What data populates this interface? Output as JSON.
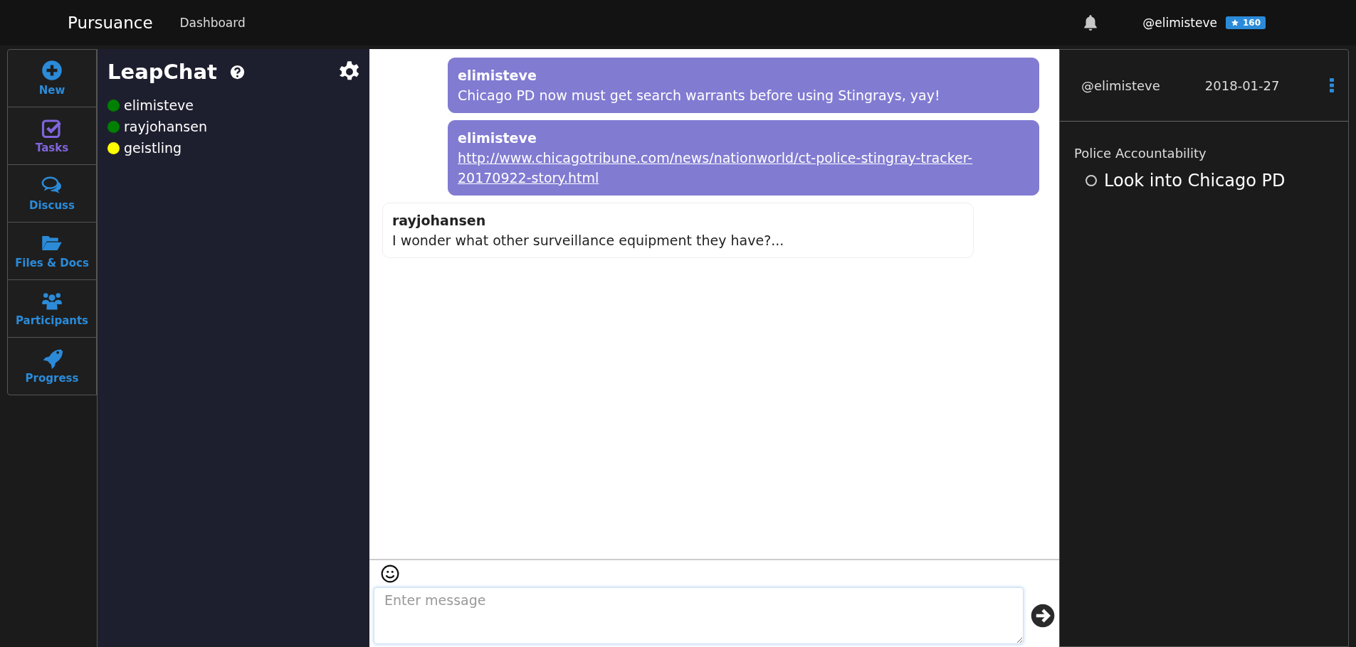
{
  "navbar": {
    "brand": "Pursuance",
    "links": [
      "Dashboard"
    ],
    "username": "@elimisteve",
    "score": "160"
  },
  "sidebar": {
    "items": [
      {
        "kind": "new",
        "label": "New",
        "selected": false
      },
      {
        "kind": "tasks",
        "label": "Tasks",
        "selected": true
      },
      {
        "kind": "discuss",
        "label": "Discuss",
        "selected": false
      },
      {
        "kind": "files",
        "label": "Files & Docs",
        "selected": false
      },
      {
        "kind": "participants",
        "label": "Participants",
        "selected": false
      },
      {
        "kind": "progress",
        "label": "Progress",
        "selected": false
      }
    ]
  },
  "chat_panel": {
    "title": "LeapChat",
    "users": [
      {
        "name": "elimisteve",
        "color": "#008000"
      },
      {
        "name": "rayjohansen",
        "color": "#008000"
      },
      {
        "name": "geistling",
        "color": "#ffff00"
      }
    ]
  },
  "messages": [
    {
      "author": "elimisteve",
      "text": "Chicago PD now must get search warrants before using Stingrays, yay!",
      "kind": "text",
      "own": true
    },
    {
      "author": "elimisteve",
      "text": "http://www.chicagotribune.com/news/nationworld/ct-police-stingray-tracker-20170922-story.html",
      "kind": "link",
      "own": true
    },
    {
      "author": "rayjohansen",
      "text": "I wonder what other surveillance equipment they have?...",
      "kind": "text",
      "own": false
    }
  ],
  "composer": {
    "placeholder": "Enter message"
  },
  "task_panel": {
    "assignee": "@elimisteve",
    "date": "2018-01-27",
    "category": "Police Accountability",
    "tasks": [
      {
        "title": "Look into Chicago PD",
        "done": false
      }
    ]
  }
}
